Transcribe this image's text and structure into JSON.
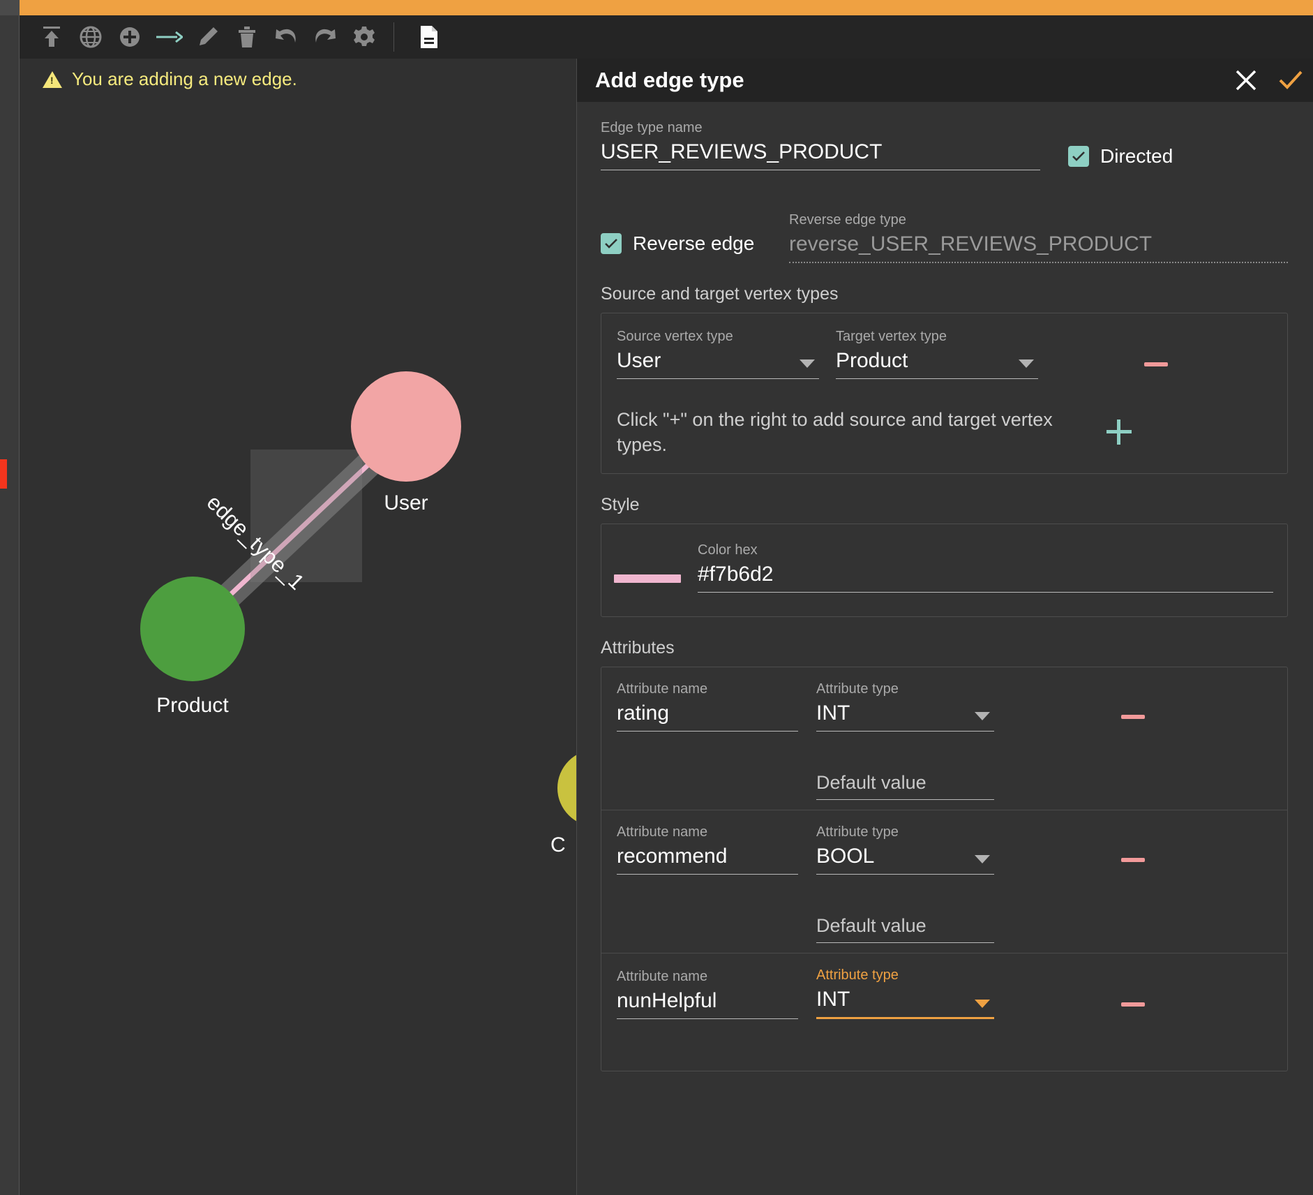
{
  "toolbar": {
    "icons": [
      {
        "name": "upload-icon",
        "title": "Upload"
      },
      {
        "name": "globe-icon",
        "title": "Global"
      },
      {
        "name": "add-circle-icon",
        "title": "Add vertex type"
      },
      {
        "name": "arrow-right-icon",
        "title": "Add edge type"
      },
      {
        "name": "pencil-icon",
        "title": "Edit"
      },
      {
        "name": "trash-icon",
        "title": "Delete"
      },
      {
        "name": "undo-icon",
        "title": "Undo"
      },
      {
        "name": "redo-icon",
        "title": "Redo"
      },
      {
        "name": "gear-icon",
        "title": "Settings"
      },
      {
        "name": "document-icon",
        "title": "Document"
      }
    ],
    "accent_active": "#8ecfc3"
  },
  "canvas": {
    "warning": "You are adding a new edge.",
    "warning_color": "#f5ea7e",
    "graph": {
      "nodes": [
        {
          "label": "User",
          "color": "#f2a5a5"
        },
        {
          "label": "Product",
          "color": "#4d9e3f"
        },
        {
          "label": "C",
          "color": "#c9c23f"
        }
      ],
      "edge_label": "edge_type_1",
      "edge_color": "#f0b6cf"
    }
  },
  "panel": {
    "title": "Add edge type",
    "close_label": "✕",
    "confirm_label": "✓",
    "confirm_color": "#efa142",
    "edge_name": {
      "label": "Edge type name",
      "value": "USER_REVIEWS_PRODUCT"
    },
    "directed": {
      "label": "Directed",
      "checked": true
    },
    "reverse_edge": {
      "label": "Reverse edge",
      "checked": true,
      "type_label": "Reverse edge type",
      "type_value": "reverse_USER_REVIEWS_PRODUCT"
    },
    "vertex_section": {
      "title": "Source and target vertex types",
      "source_label": "Source vertex type",
      "source_value": "User",
      "target_label": "Target vertex type",
      "target_value": "Product",
      "hint": "Click \"+\" on the right to add source and target vertex types."
    },
    "style_section": {
      "title": "Style",
      "color_label": "Color hex",
      "color_value": "#f7b6d2"
    },
    "attributes_section": {
      "title": "Attributes",
      "name_label": "Attribute name",
      "type_label": "Attribute type",
      "default_label": "Default value",
      "rows": [
        {
          "name": "rating",
          "type": "INT",
          "default": "",
          "focused": false
        },
        {
          "name": "recommend",
          "type": "BOOL",
          "default": "",
          "focused": false
        },
        {
          "name": "nunHelpful",
          "type": "INT",
          "default": "",
          "focused": true
        }
      ]
    }
  }
}
